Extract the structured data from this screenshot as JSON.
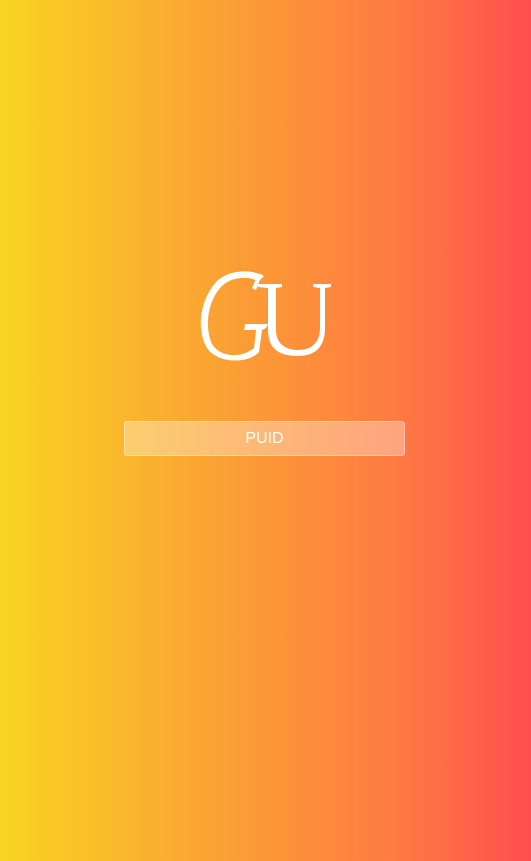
{
  "logo": {
    "text": "GU",
    "icon": "gu-logo-icon"
  },
  "login": {
    "puid_placeholder": "PUID",
    "puid_value": ""
  },
  "colors": {
    "gradient_left": "#f9d423",
    "gradient_right": "#ff4e50",
    "field_text": "#ffffff"
  }
}
